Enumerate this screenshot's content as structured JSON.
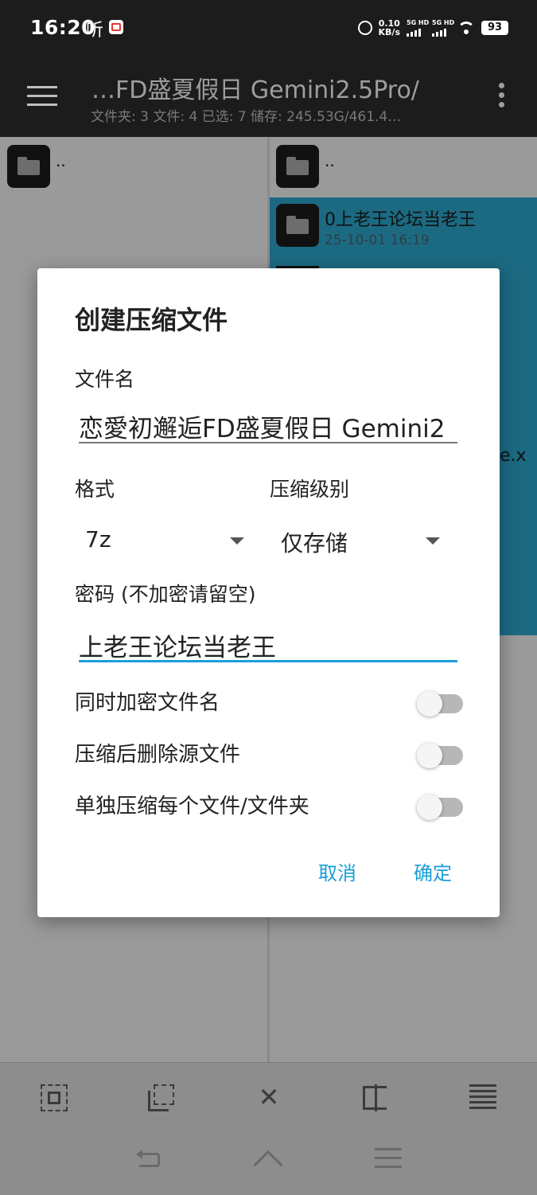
{
  "statusbar": {
    "time": "16:20",
    "listen": "听",
    "net_speed": "0.10",
    "net_unit": "KB/s",
    "sim1": "5G HD",
    "sim2": "5G HD",
    "battery": "93"
  },
  "appbar": {
    "path": "…FD盛夏假日 Gemini2.5Pro/",
    "stats": "文件夹: 3  文件: 4  已选: 7  储存: 245.53G/461.4…"
  },
  "left_pane": {
    "parent": ".."
  },
  "right_pane": {
    "parent": "..",
    "item_name": "0上老王论坛当老王",
    "item_date": "25-10-01 16:19",
    "peek_text": "e.x"
  },
  "dialog": {
    "title": "创建压缩文件",
    "filename_label": "文件名",
    "filename_value": "恋愛初邂逅FD盛夏假日 Gemini2",
    "format_label": "格式",
    "format_value": "7z",
    "level_label": "压缩级别",
    "level_value": "仅存储",
    "password_label": "密码 (不加密请留空)",
    "password_value": "上老王论坛当老王",
    "opt_encrypt_names": "同时加密文件名",
    "opt_delete_source": "压缩后删除源文件",
    "opt_separate": "单独压缩每个文件/文件夹",
    "cancel": "取消",
    "ok": "确定"
  },
  "toolbar": {
    "close_glyph": "✕"
  },
  "icons": {
    "menu": "hamburger-icon",
    "more": "more-vert-icon",
    "folder": "folder-icon",
    "select_all": "select-all-icon",
    "select_range": "select-range-icon",
    "close": "close-icon",
    "invert": "invert-selection-icon",
    "list": "list-icon"
  },
  "colors": {
    "accent": "#1aa0d8",
    "selected_row": "#1c6a82"
  }
}
